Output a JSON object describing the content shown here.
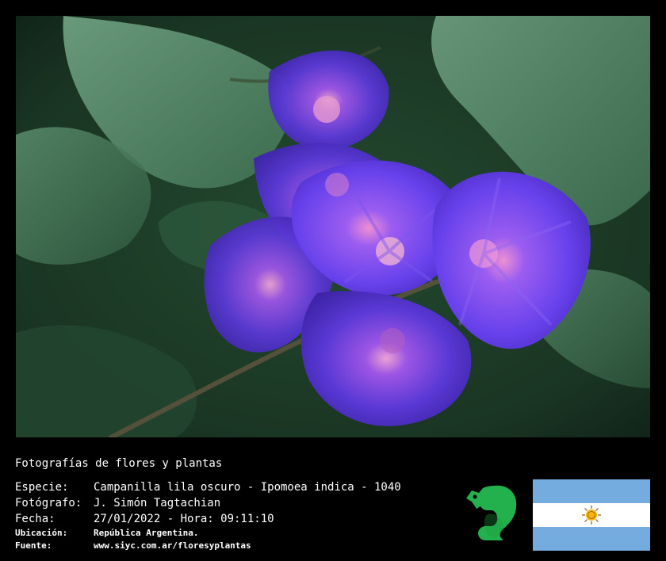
{
  "title": "Fotografías de flores y plantas",
  "fields": [
    {
      "label": "Especie:",
      "value": "Campanilla lila oscuro - Ipomoea indica - 1040"
    },
    {
      "label": "Fotógrafo:",
      "value": "J. Simón Tagtachian"
    },
    {
      "label": "Fecha:",
      "value": "27/01/2022 - Hora: 09:11:10"
    }
  ],
  "details": [
    {
      "label": "Ubicación:",
      "value": "República Argentina."
    },
    {
      "label": "Fuente:",
      "value": "www.siyc.com.ar/floresyplantas"
    }
  ],
  "colors": {
    "background": "#000000",
    "text": "#ffffff",
    "flower": "#5b3ad8",
    "foliage": "#3f7a55",
    "logo": "#22b14c",
    "flag_blue": "#74acdf",
    "flag_sun": "#f6b40e"
  },
  "icons": {
    "logo": "green-squirrel-icon",
    "flag": "argentina-flag-icon"
  }
}
